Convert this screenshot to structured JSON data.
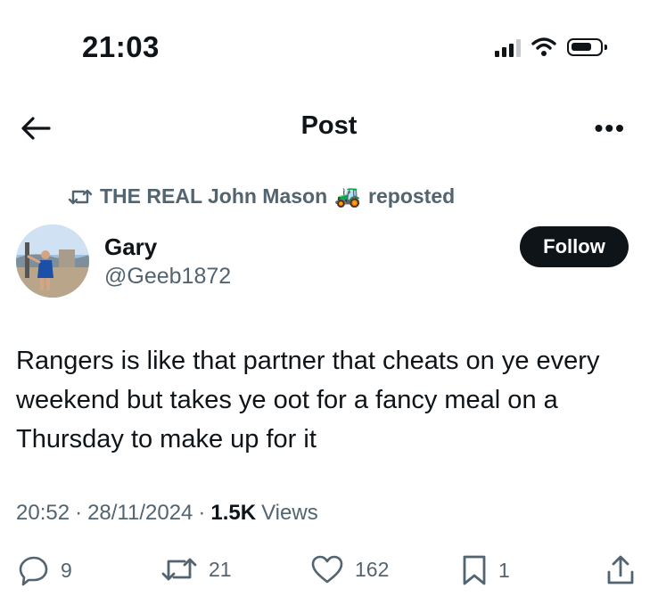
{
  "status_bar": {
    "time": "21:03",
    "icons": [
      "cellular-signal-icon",
      "wifi-icon",
      "battery-icon"
    ]
  },
  "header": {
    "title": "Post",
    "back_icon": "back-arrow-icon",
    "more_icon": "more-options-icon",
    "more_label": "•••"
  },
  "repost_banner": {
    "icon": "repost-icon",
    "user": "THE REAL John Mason",
    "emoji": "🚜",
    "suffix": "reposted"
  },
  "author": {
    "name": "Gary",
    "handle": "@Geeb1872",
    "follow_label": "Follow"
  },
  "post": {
    "text": "Rangers is like that partner that cheats on ye every weekend but takes ye oot for a fancy meal on a Thursday to make up for it",
    "time": "20:52",
    "date": "28/11/2024",
    "views_count": "1.5K",
    "views_label": "Views"
  },
  "actions": {
    "replies": "9",
    "reposts": "21",
    "likes": "162",
    "bookmarks": "1"
  },
  "colors": {
    "text": "#0f1419",
    "secondary": "#536471",
    "button_bg": "#0f1419"
  }
}
